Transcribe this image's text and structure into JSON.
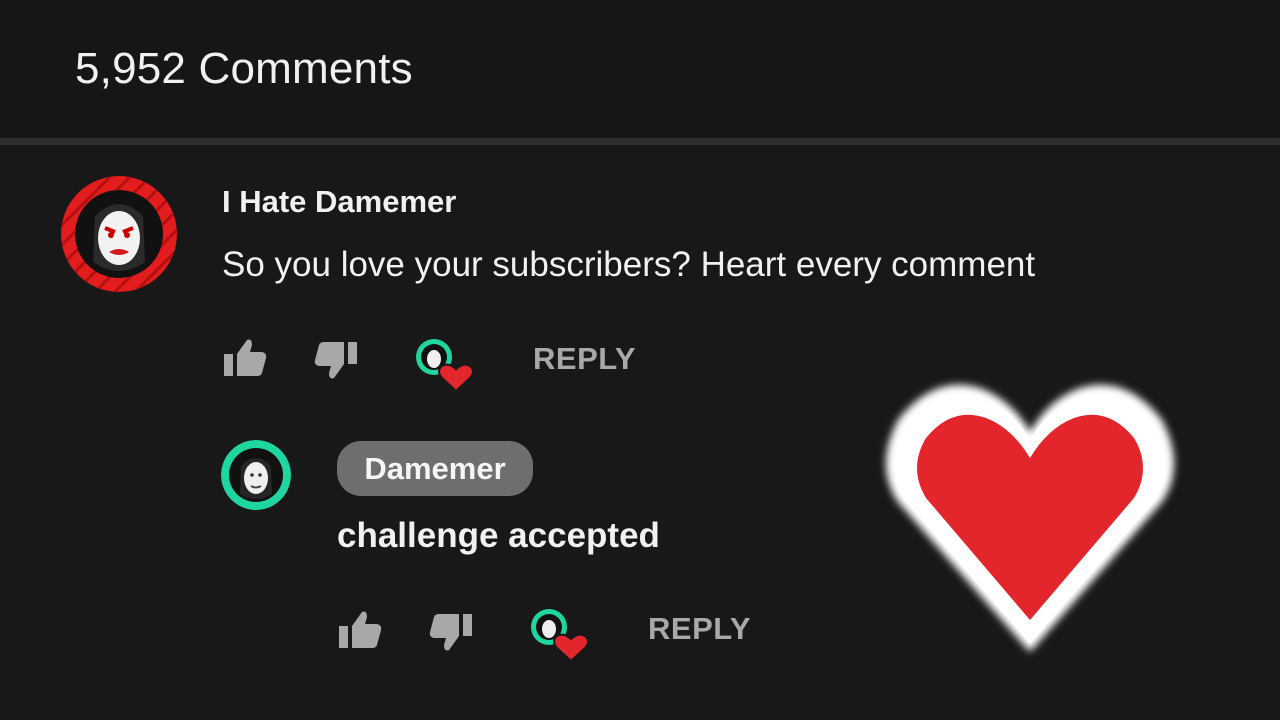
{
  "header": {
    "comment_count": "5,952 Comments"
  },
  "comment": {
    "author": "I Hate Damemer",
    "text": "So you love your subscribers? Heart every comment",
    "avatar_icon": "angry-face-avatar-icon",
    "reply_label": "REPLY",
    "hearted_by_creator": true
  },
  "reply": {
    "author": "Damemer",
    "author_is_creator": true,
    "text": "challenge accepted",
    "avatar_icon": "creator-face-avatar-icon",
    "reply_label": "REPLY",
    "hearted_by_creator": true
  },
  "icons": {
    "like": "thumbs-up-icon",
    "dislike": "thumbs-down-icon",
    "creator_heart": "creator-heart-icon",
    "big_heart": "heart-icon"
  },
  "colors": {
    "background": "#181818",
    "header_background": "#161616",
    "text": "#f1f1f1",
    "muted": "#a8a8a8",
    "heart_red": "#e3262c",
    "creator_ring": "#1fd6a0",
    "avatar_red": "#e31d1d",
    "badge_gray": "#6e6e6e"
  }
}
